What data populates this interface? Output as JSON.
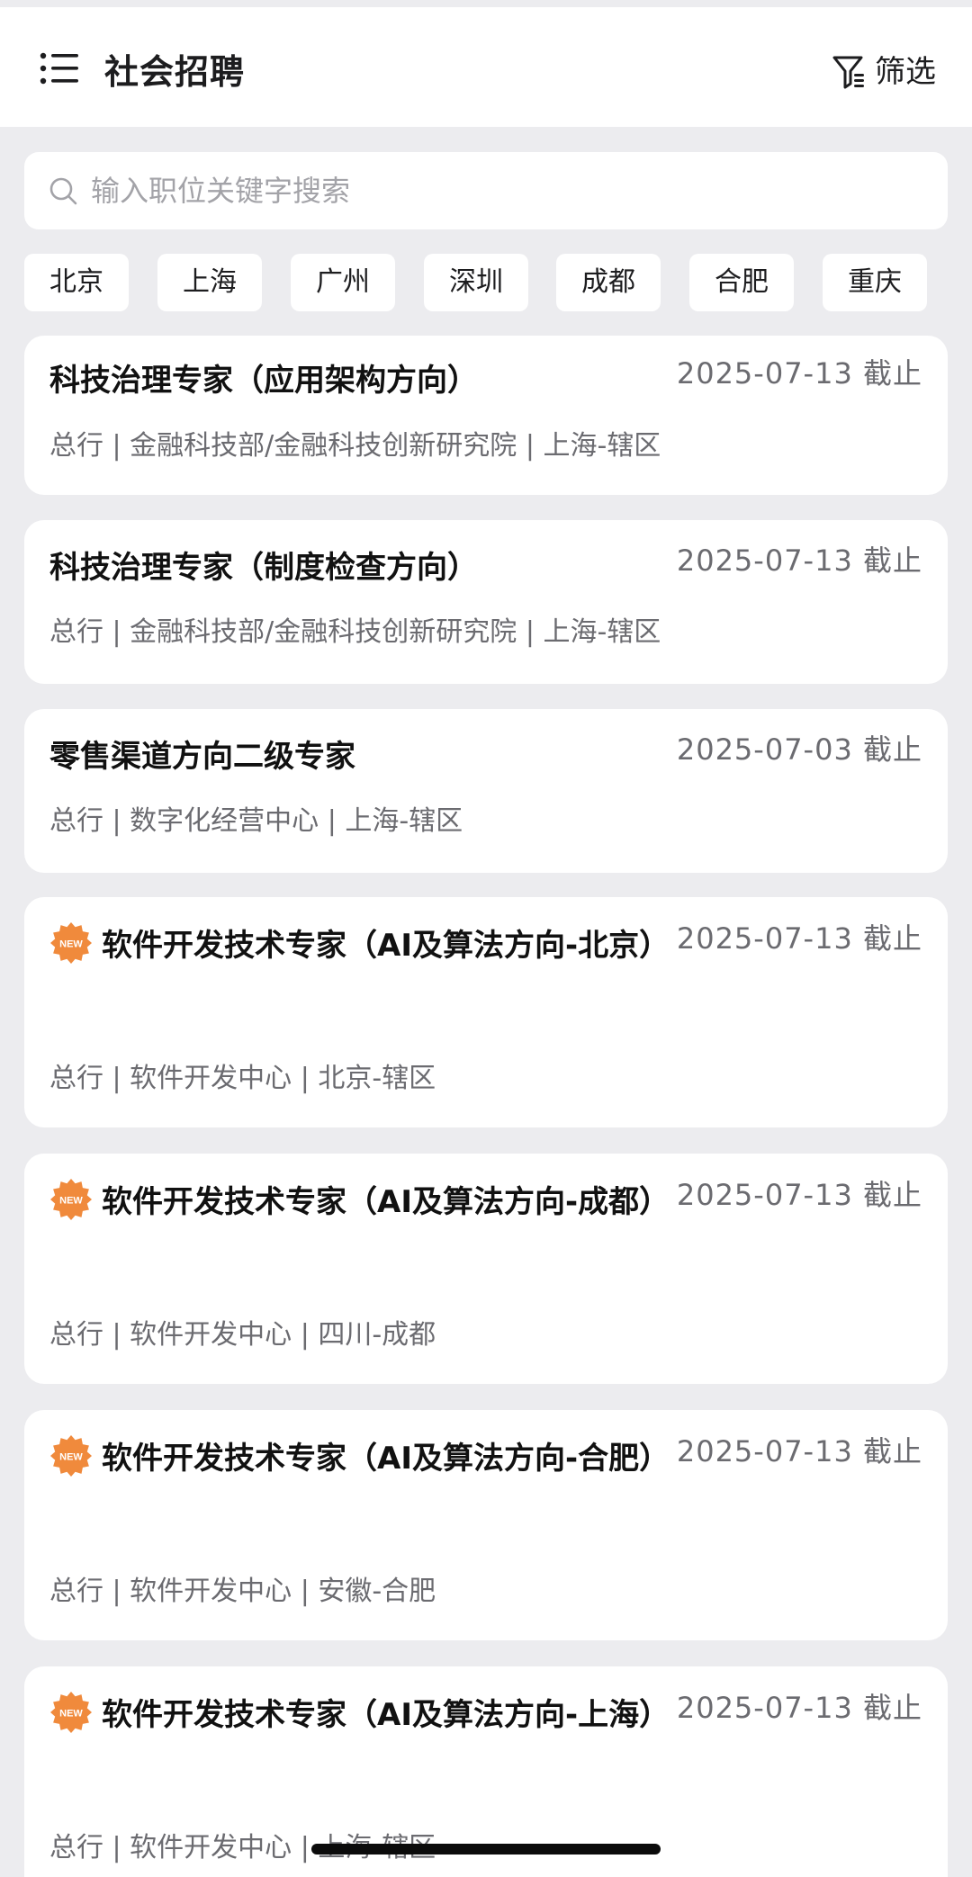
{
  "header": {
    "title": "社会招聘",
    "filter_label": "筛选"
  },
  "search": {
    "placeholder": "输入职位关键字搜索",
    "value": ""
  },
  "cities": [
    "北京",
    "上海",
    "广州",
    "深圳",
    "成都",
    "合肥",
    "重庆"
  ],
  "jobs": [
    {
      "title": "科技治理专家（应用架构方向）",
      "deadline": "2025-07-13 截止",
      "meta": "总行 | 金融科技部/金融科技创新研究院 | 上海-辖区",
      "is_new": false
    },
    {
      "title": "科技治理专家（制度检查方向）",
      "deadline": "2025-07-13 截止",
      "meta": "总行 | 金融科技部/金融科技创新研究院 | 上海-辖区",
      "is_new": false
    },
    {
      "title": "零售渠道方向二级专家",
      "deadline": "2025-07-03 截止",
      "meta": "总行 | 数字化经营中心 | 上海-辖区",
      "is_new": false
    },
    {
      "title": "软件开发技术专家（AI及算法方向-北京）",
      "deadline": "2025-07-13 截止",
      "meta": "总行 | 软件开发中心 | 北京-辖区",
      "is_new": true
    },
    {
      "title": "软件开发技术专家（AI及算法方向-成都）",
      "deadline": "2025-07-13 截止",
      "meta": "总行 | 软件开发中心 | 四川-成都",
      "is_new": true
    },
    {
      "title": "软件开发技术专家（AI及算法方向-合肥）",
      "deadline": "2025-07-13 截止",
      "meta": "总行 | 软件开发中心 | 安徽-合肥",
      "is_new": true
    },
    {
      "title": "软件开发技术专家（AI及算法方向-上海）",
      "deadline": "2025-07-13 截止",
      "meta": "总行 | 软件开发中心 | 上海-辖区",
      "is_new": true
    }
  ],
  "badge": {
    "label": "NEW",
    "color": "#f08a3c"
  },
  "icons": {
    "menu": "menu-list-icon",
    "filter": "filter-icon",
    "search": "search-icon",
    "new": "new-badge-icon"
  }
}
